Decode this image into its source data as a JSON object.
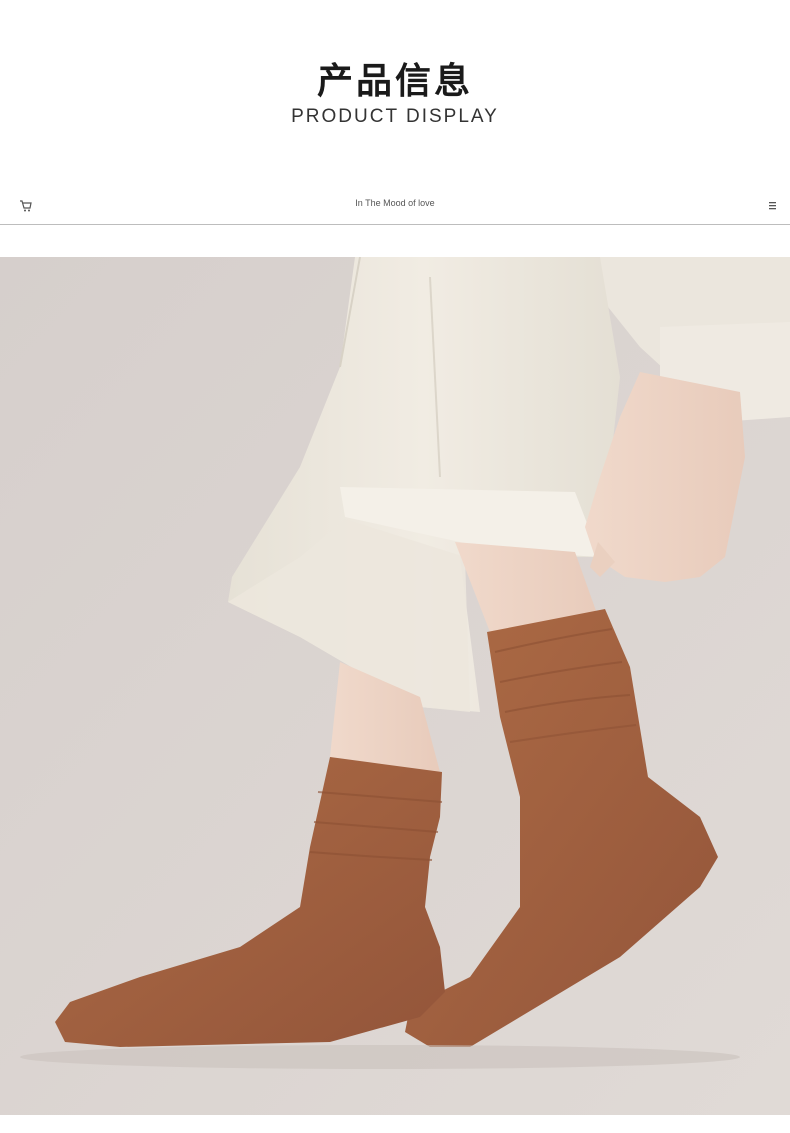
{
  "header": {
    "title_cn": "产品信息",
    "title_en": "PRODUCT DISPLAY"
  },
  "bar": {
    "tagline": "In The Mood of  love",
    "left_icon": "cart-icon",
    "right_icon": "menu-icon"
  },
  "photo": {
    "subject": "product-photo-brown-socks",
    "sock_color": "#a4623f",
    "background_color": "#d9d3d0",
    "pants_color": "#eee9e0"
  }
}
